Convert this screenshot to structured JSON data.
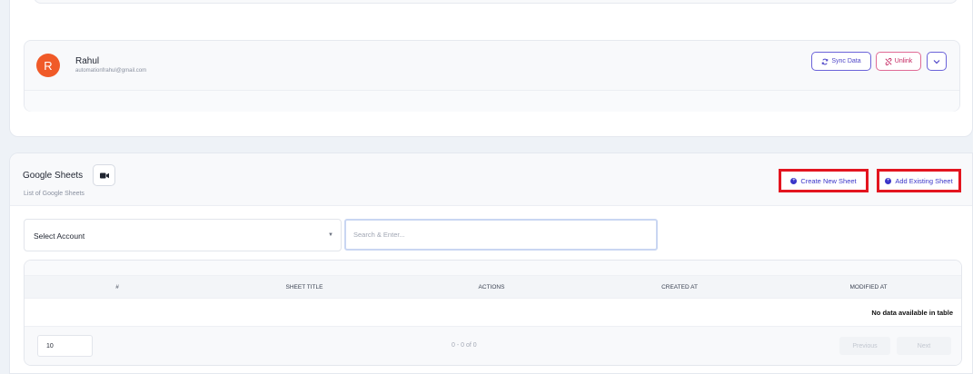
{
  "account": {
    "avatar_letter": "R",
    "name": "Rahul",
    "email": "automationfrahul@gmail.com",
    "sync_label": "Sync Data",
    "unlink_label": "Unlink"
  },
  "sheets": {
    "title": "Google Sheets",
    "subtitle": "List of Google Sheets",
    "create_label": "Create New Sheet",
    "add_label": "Add Existing Sheet",
    "select_account_label": "Select Account",
    "search_placeholder": "Search & Enter...",
    "columns": [
      "#",
      "SHEET TITLE",
      "ACTIONS",
      "CREATED AT",
      "MODIFIED AT"
    ],
    "empty_message": "No data available in table",
    "page_size": "10",
    "range_text": "0 - 0 of 0",
    "prev_label": "Previous",
    "next_label": "Next"
  },
  "colors": {
    "accent": "#4f46c8",
    "avatar": "#f05a28",
    "danger": "#c4245f",
    "highlight_box": "#e3151f"
  },
  "icons": {
    "sync": "sync-icon",
    "unlink": "unlink-icon",
    "chevron": "chevron-down-icon",
    "video": "video-icon",
    "plus": "plus-circle-icon",
    "caret": "caret-down-icon"
  }
}
